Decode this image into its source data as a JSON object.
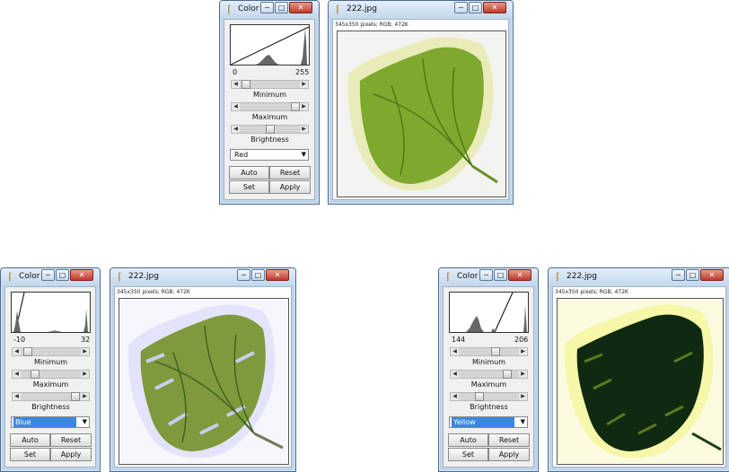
{
  "color_dialog_top": {
    "title": "Color",
    "range_min": "0",
    "range_max": "255",
    "min_label": "Minimum",
    "max_label": "Maximum",
    "brightness_label": "Brightness",
    "channel": "Red",
    "auto_label": "Auto",
    "reset_label": "Reset",
    "set_label": "Set",
    "apply_label": "Apply"
  },
  "image_window_top": {
    "title": "222.jpg",
    "info": "345x350 pixels; RGB; 472K"
  },
  "color_dialog_left": {
    "title": "Color",
    "range_min": "-10",
    "range_max": "32",
    "min_label": "Minimum",
    "max_label": "Maximum",
    "brightness_label": "Brightness",
    "channel": "Blue",
    "auto_label": "Auto",
    "reset_label": "Reset",
    "set_label": "Set",
    "apply_label": "Apply"
  },
  "image_window_left": {
    "title": "222.jpg",
    "info": "345x350 pixels; RGB; 472K"
  },
  "color_dialog_right": {
    "title": "Color",
    "range_min": "144",
    "range_max": "206",
    "min_label": "Minimum",
    "max_label": "Maximum",
    "brightness_label": "Brightness",
    "channel": "Yellow",
    "auto_label": "Auto",
    "reset_label": "Reset",
    "set_label": "Set",
    "apply_label": "Apply"
  },
  "image_window_right": {
    "title": "222.jpg",
    "info": "345x350 pixels; RGB; 472K"
  },
  "colors": {
    "selection_highlight": "#3a87e0",
    "close_button": "#c0392b",
    "leaf_green": "#7fa82e",
    "leaf_cream": "#eef0c0",
    "leaf_dark": "#0f2a10"
  }
}
